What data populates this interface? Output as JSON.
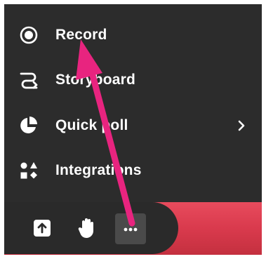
{
  "menu": {
    "items": [
      {
        "label": "Record",
        "icon": "record-icon"
      },
      {
        "label": "Storyboard",
        "icon": "storyboard-icon"
      },
      {
        "label": "Quick poll",
        "icon": "pie-chart-icon",
        "has_submenu": true
      },
      {
        "label": "Integrations",
        "icon": "shapes-icon"
      }
    ]
  },
  "toolbar": {
    "buttons": [
      {
        "icon": "upload-icon"
      },
      {
        "icon": "raise-hand-icon"
      },
      {
        "icon": "more-options-icon",
        "active": true
      }
    ]
  },
  "colors": {
    "menu_background": "#2c2c2c",
    "text": "#ffffff",
    "accent_band": "#d93a4d",
    "active_button": "#4a4a4a",
    "annotation_arrow": "#e8247f"
  }
}
